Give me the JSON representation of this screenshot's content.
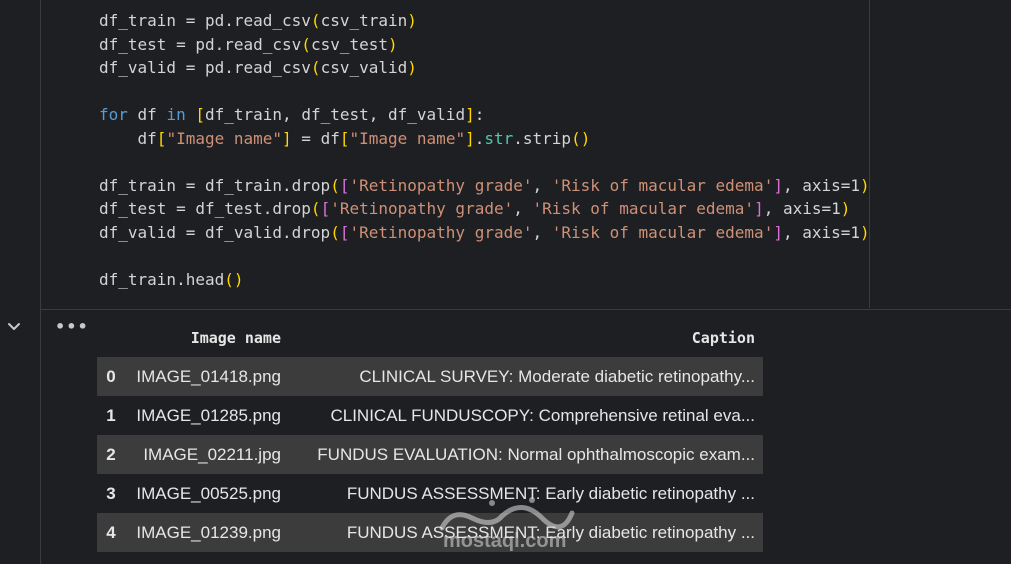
{
  "code": {
    "lines": [
      "df_train = pd.read_csv(csv_train)",
      "df_test = pd.read_csv(csv_test)",
      "df_valid = pd.read_csv(csv_valid)",
      "",
      "for df in [df_train, df_test, df_valid]:",
      "    df[\"Image name\"] = df[\"Image name\"].str.strip()",
      "",
      "df_train = df_train.drop(['Retinopathy grade', 'Risk of macular edema'], axis=1)",
      "df_test = df_test.drop(['Retinopathy grade', 'Risk of macular edema'], axis=1)",
      "df_valid = df_valid.drop(['Retinopathy grade', 'Risk of macular edema'], axis=1)",
      "",
      "df_train.head()"
    ]
  },
  "output": {
    "collapse_icon": "chevron-down-icon",
    "more_icon": "more-horizontal-icon",
    "more_label": "•••",
    "columns": [
      "",
      "Image name",
      "Caption"
    ],
    "rows": [
      {
        "index": "0",
        "image_name": "IMAGE_01418.png",
        "caption": "CLINICAL SURVEY: Moderate diabetic retinopathy..."
      },
      {
        "index": "1",
        "image_name": "IMAGE_01285.png",
        "caption": "CLINICAL FUNDUSCOPY: Comprehensive retinal eva..."
      },
      {
        "index": "2",
        "image_name": "IMAGE_02211.jpg",
        "caption": "FUNDUS EVALUATION: Normal ophthalmoscopic exam..."
      },
      {
        "index": "3",
        "image_name": "IMAGE_00525.png",
        "caption": "FUNDUS ASSESSMENT: Early diabetic retinopathy ..."
      },
      {
        "index": "4",
        "image_name": "IMAGE_01239.png",
        "caption": "FUNDUS ASSESSMENT: Early diabetic retinopathy ..."
      }
    ]
  },
  "watermark": {
    "text": "mostaql.com"
  },
  "colors": {
    "background": "#1e1f22",
    "row_stripe": "#3c3c3c",
    "keyword": "#569cd6",
    "string": "#ce9178",
    "method": "#4ec9b0",
    "bracket_outer": "#ffd700",
    "bracket_inner": "#da70d6"
  }
}
